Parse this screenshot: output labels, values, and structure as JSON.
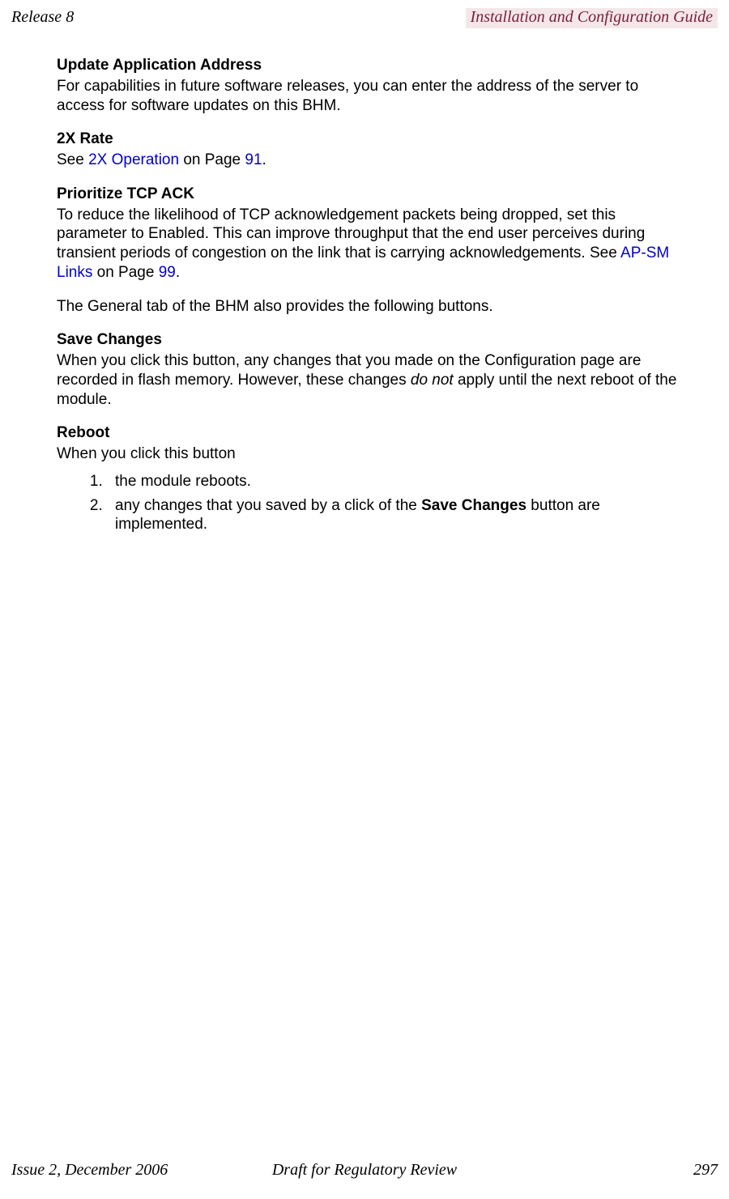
{
  "header": {
    "left": "Release 8",
    "right": "Installation and Configuration Guide"
  },
  "sections": {
    "updateAddr": {
      "heading": "Update Application Address",
      "body": "For capabilities in future software releases, you can enter the address of the server to access for software updates on this BHM."
    },
    "rate2x": {
      "heading": "2X Rate",
      "see_prefix": "See ",
      "link": "2X Operation",
      "mid": " on Page ",
      "page": "91",
      "suffix": "."
    },
    "prioritize": {
      "heading": "Prioritize TCP ACK",
      "body_prefix": "To reduce the likelihood of TCP acknowledgement packets being dropped, set this parameter to Enabled. This can improve throughput that the end user perceives during transient periods of congestion on the link that is carrying acknowledgements. See ",
      "link": "AP-SM Links",
      "mid": " on Page ",
      "page": "99",
      "suffix": "."
    },
    "generalTabNote": "The General tab of the BHM also provides the following buttons.",
    "saveChanges": {
      "heading": "Save Changes",
      "body_prefix": "When you click this button, any changes that you made on the Configuration page are recorded in flash memory. However, these changes ",
      "italic": "do not",
      "body_suffix": " apply until the next reboot of the module."
    },
    "reboot": {
      "heading": "Reboot",
      "intro": "When you click this button",
      "items": {
        "one": "the module reboots.",
        "two_prefix": "any changes that you saved by a click of the ",
        "two_bold": "Save Changes",
        "two_suffix": " button are implemented."
      }
    }
  },
  "footer": {
    "left": "Issue 2, December 2006",
    "center": "Draft for Regulatory Review",
    "right": "297"
  }
}
